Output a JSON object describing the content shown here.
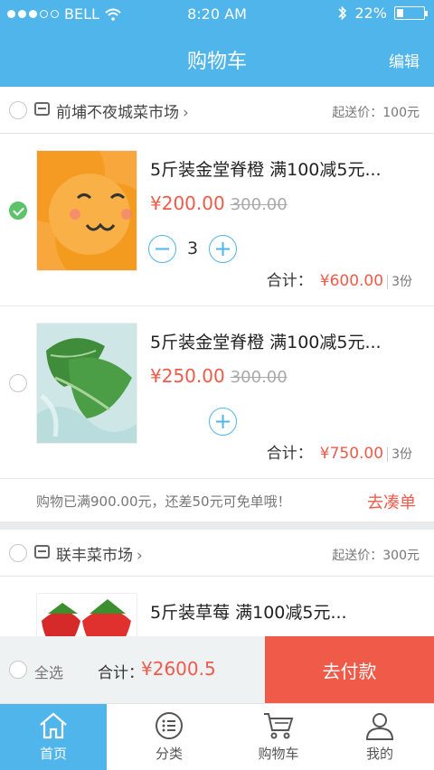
{
  "status": {
    "carrier": "BELL",
    "time": "8:20 AM",
    "battery": "22%"
  },
  "header": {
    "title": "购物车",
    "edit_label": "编辑"
  },
  "stores": [
    {
      "name": "前埔不夜城菜市场",
      "min_order": "起送价：100元",
      "items": [
        {
          "name": "5斤装金堂脊橙 满100减5元...",
          "price": "¥200.00",
          "old_price": "300.00",
          "qty": "3",
          "subtotal_label": "合计：",
          "subtotal": "¥600.00",
          "count": "3份",
          "checked": true
        },
        {
          "name": "5斤装金堂脊橙 满100减5元...",
          "price": "¥250.00",
          "old_price": "300.00",
          "subtotal_label": "合计：",
          "subtotal": "¥750.00",
          "count": "3份",
          "checked": false
        }
      ],
      "promo_text": "购物已满900.00元，还差50元可免单哦！",
      "promo_link": "去凑单"
    },
    {
      "name": "联丰菜市场",
      "min_order": "起送价：300元",
      "items": [
        {
          "name": "5斤装草莓 满100减5元..."
        }
      ]
    }
  ],
  "checkout": {
    "select_all": "全选",
    "total_label": "合计：",
    "total": "¥2600.5",
    "pay_label": "去付款"
  },
  "tabs": [
    {
      "label": "首页",
      "icon": "home-icon",
      "active": true
    },
    {
      "label": "分类",
      "icon": "category-icon",
      "active": false
    },
    {
      "label": "购物车",
      "icon": "cart-icon",
      "active": false
    },
    {
      "label": "我的",
      "icon": "user-icon",
      "active": false
    }
  ],
  "colors": {
    "primary": "#4fb5ea",
    "accent": "#f05a4a",
    "check": "#5cc36b"
  }
}
